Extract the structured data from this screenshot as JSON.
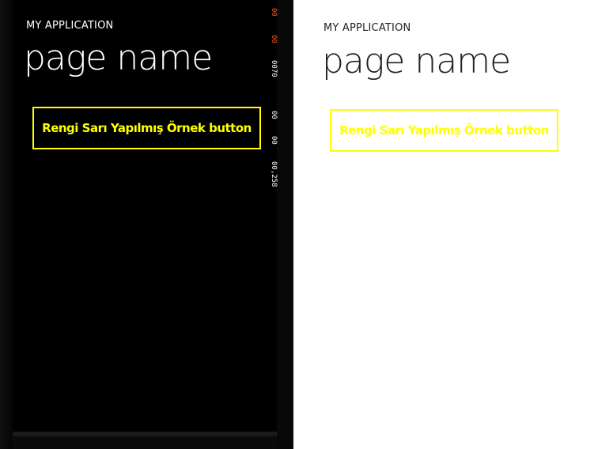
{
  "dark_phone": {
    "app_title": "MY APPLICATION",
    "page_title": "page name",
    "button_label": "Rengi Sarı Yapılmış Örnek button",
    "theme": "dark",
    "background_color": "#000000",
    "text_color": "#ffffff",
    "button_color": "#ffff00",
    "frame_counters": [
      "00",
      "00",
      "0070",
      "00",
      "00",
      "00,258"
    ],
    "frame_counter_colors": [
      "#ff5a1f",
      "#ff5a1f",
      "#ffffff",
      "#ffffff",
      "#ffffff",
      "#ffffff"
    ]
  },
  "light_phone": {
    "app_title": "MY APPLICATION",
    "page_title": "page name",
    "button_label": "Rengi Sarı Yapılmış Örnek button",
    "theme": "light",
    "background_color": "#ffffff",
    "text_color": "#222222",
    "button_color": "#ffff00"
  }
}
